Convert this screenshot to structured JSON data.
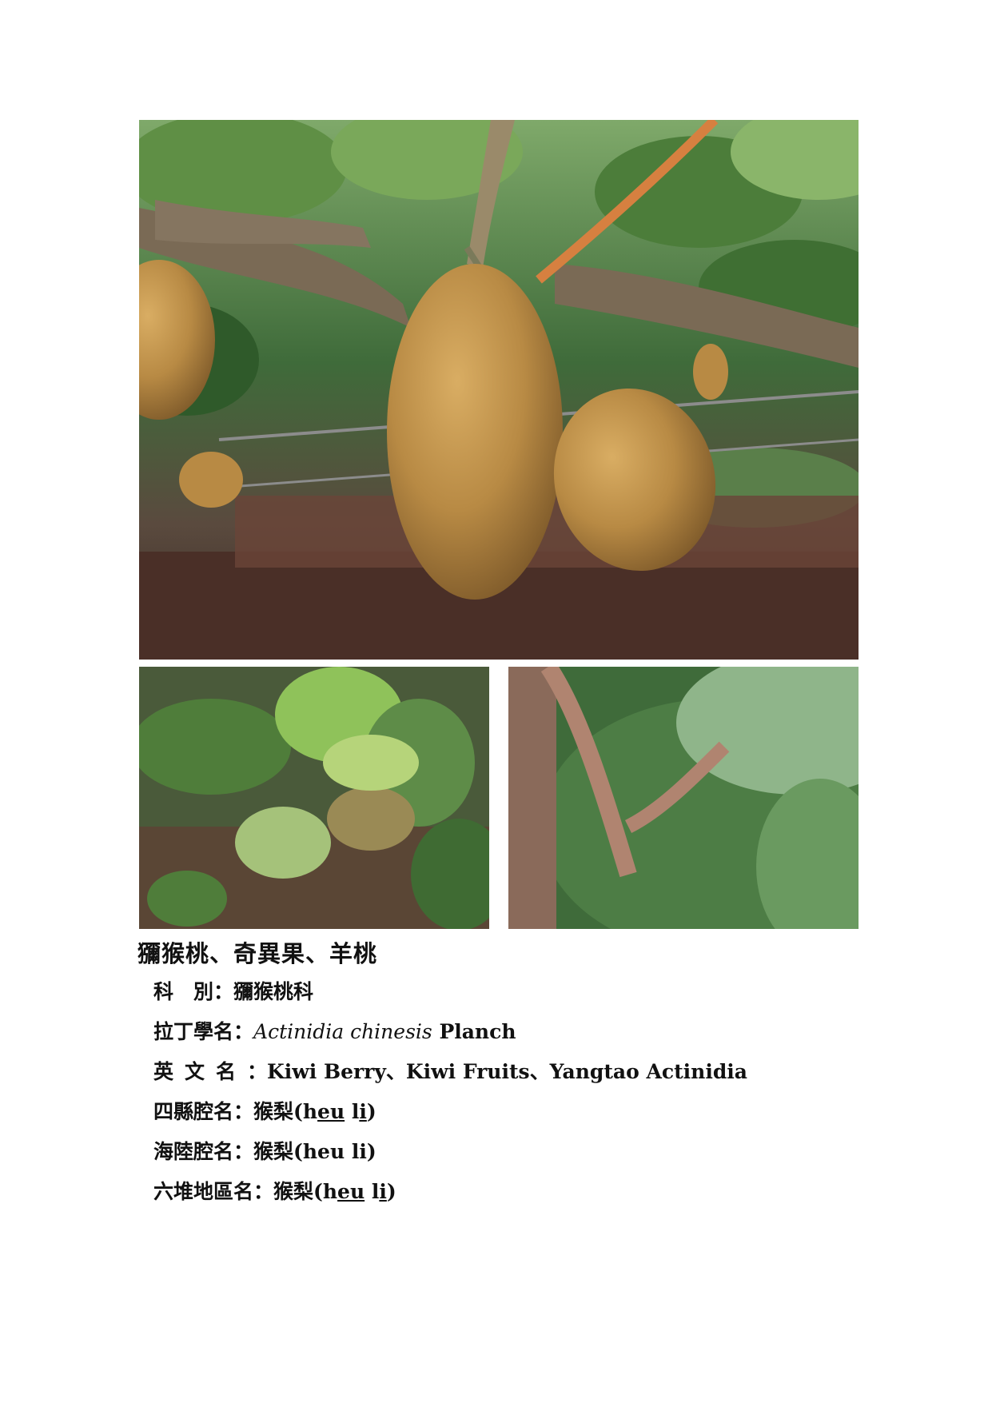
{
  "title": "獼猴桃、奇異果、羊桃",
  "photos": {
    "main": "kiwifruit-on-vine-photo",
    "left": "kiwi-leaves-photo",
    "right": "hairy-petiole-leaf-photo"
  },
  "fields": {
    "family": {
      "label": "科　別",
      "colon": "：",
      "value": "獼猴桃科"
    },
    "latin": {
      "label": "拉丁學名",
      "colon": "：",
      "value_italic": "Actinidia chinesis",
      "value_rest": " Planch"
    },
    "english": {
      "label": "英文名",
      "colon": "：",
      "value": "Kiwi Berry、Kiwi Fruits、Yangtao Actinidia"
    },
    "sixian": {
      "label": "四縣腔名",
      "colon": "：",
      "value_pre": "猴梨(h",
      "value_u1": "eu",
      "value_mid": " l",
      "value_u2": "i",
      "value_post": ")"
    },
    "hailu": {
      "label": "海陸腔名",
      "colon": "：",
      "value": "猴梨(heu li)"
    },
    "liudui": {
      "label": "六堆地區名",
      "colon": "：",
      "value_pre": "猴梨(h",
      "value_u1": "eu",
      "value_mid": " l",
      "value_u2": "i",
      "value_post": ")"
    }
  },
  "colors": {
    "fruit": "#b88a44",
    "leaf": "#4f7d3a",
    "branch": "#7a6a55",
    "fence": "#5b3a2e"
  }
}
